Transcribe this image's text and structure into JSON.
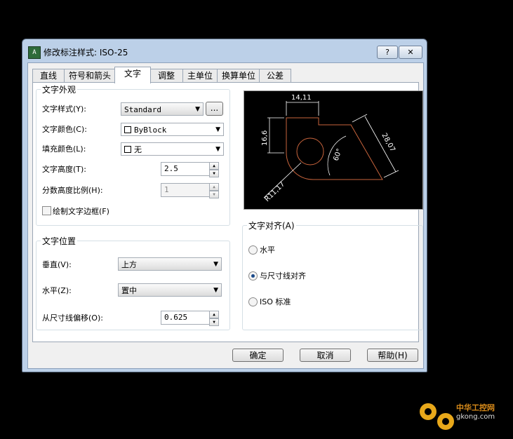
{
  "window": {
    "title": "修改标注样式: ISO-25",
    "help_button": "?",
    "close_button": "✕"
  },
  "tabs": [
    {
      "label": "直线"
    },
    {
      "label": "符号和箭头"
    },
    {
      "label": "文字"
    },
    {
      "label": "调整"
    },
    {
      "label": "主单位"
    },
    {
      "label": "换算单位"
    },
    {
      "label": "公差"
    }
  ],
  "active_tab": "文字",
  "text_appearance": {
    "title": "文字外观",
    "style_label": "文字样式(Y):",
    "style_value": "Standard",
    "style_browse": "...",
    "color_label": "文字颜色(C):",
    "color_value": "ByBlock",
    "fill_label": "填充颜色(L):",
    "fill_value": "无",
    "height_label": "文字高度(T):",
    "height_value": "2.5",
    "fraction_label": "分数高度比例(H):",
    "fraction_value": "1",
    "frame_label": "绘制文字边框(F)",
    "frame_checked": false
  },
  "text_placement": {
    "title": "文字位置",
    "vertical_label": "垂直(V):",
    "vertical_value": "上方",
    "horizontal_label": "水平(Z):",
    "horizontal_value": "置中",
    "offset_label": "从尺寸线偏移(O):",
    "offset_value": "0.625"
  },
  "text_alignment": {
    "title": "文字对齐(A)",
    "options": [
      "水平",
      "与尺寸线对齐",
      "ISO 标准"
    ],
    "selected": "与尺寸线对齐"
  },
  "preview": {
    "dim_top": "14,11",
    "dim_left": "16,6",
    "dim_right": "28,07",
    "dim_angle": "60°",
    "dim_radius": "R11,17",
    "line_color": "#c8643c"
  },
  "footer": {
    "ok": "确定",
    "cancel": "取消",
    "help": "帮助(H)"
  },
  "watermark": {
    "brand": "中华工控网",
    "url": "gkong.com"
  }
}
